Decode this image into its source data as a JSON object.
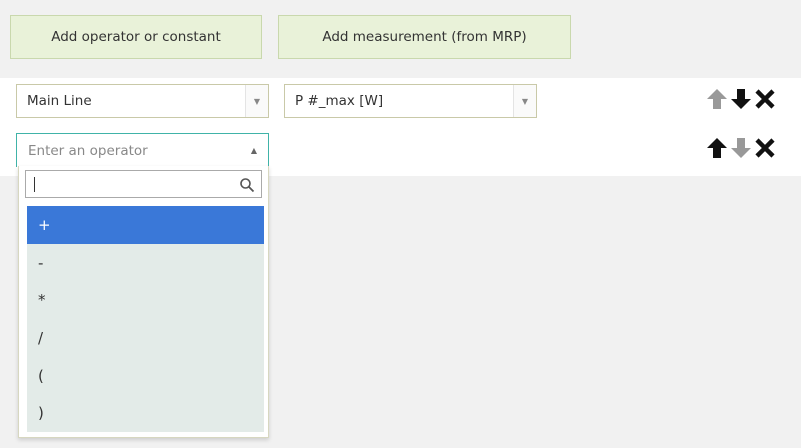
{
  "toolbar": {
    "add_operator_label": "Add operator or constant",
    "add_measurement_label": "Add measurement (from MRP)"
  },
  "rows": [
    {
      "source_select": "Main Line",
      "measurement_select": "P #_max [W]",
      "controls": [
        "arrow-up-icon (disabled)",
        "arrow-down-icon",
        "delete-icon"
      ]
    },
    {
      "operator_placeholder": "Enter an operator",
      "controls": [
        "arrow-up-icon",
        "arrow-down-icon (disabled)",
        "delete-icon"
      ]
    }
  ],
  "operator_dropdown": {
    "search_value": "",
    "options": [
      "+",
      "-",
      "*",
      "/",
      "(",
      ")"
    ],
    "selected_index": 0
  },
  "colors": {
    "button_bg": "#e9f2d9",
    "select_border": "#c9c9a8",
    "focus_border": "#40b3a8",
    "selected_option": "#3a78d8",
    "option_bg": "#e3ebe8",
    "icon_active": "#111111",
    "icon_disabled": "#999999"
  }
}
